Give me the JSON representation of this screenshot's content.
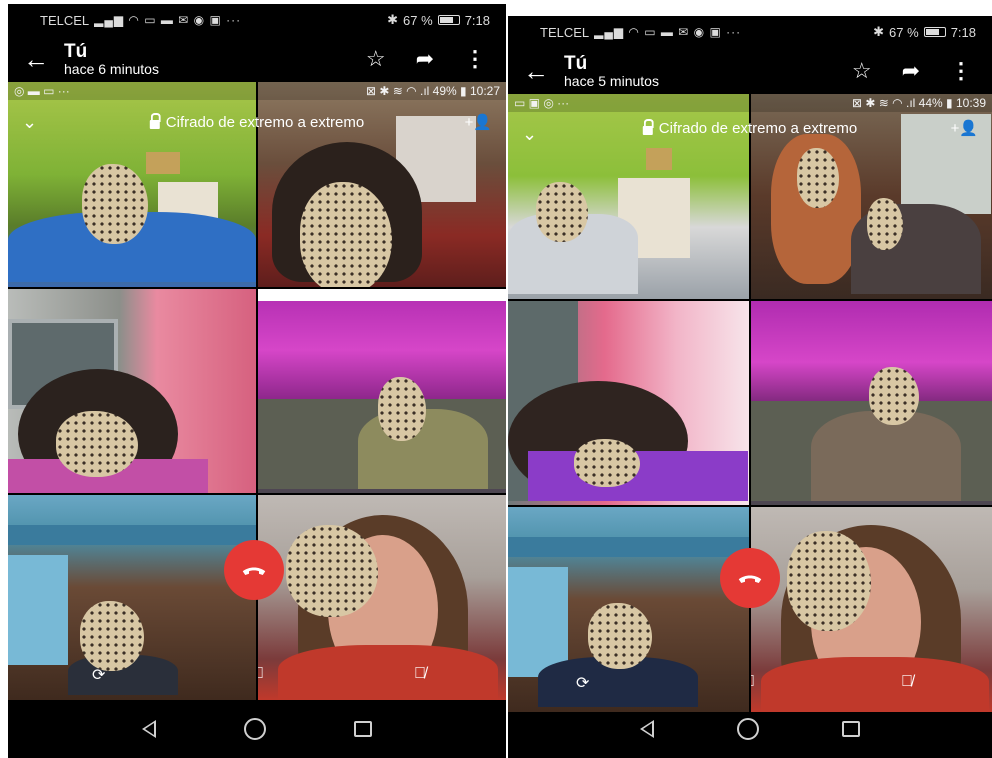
{
  "screens": [
    {
      "carrier": "TELCEL",
      "bluetooth_icon": "bluetooth-icon",
      "battery_percent": "67 %",
      "battery_level": 0.67,
      "time": "7:18",
      "contact_name": "Tú",
      "last_seen": "hace 6 minutos",
      "inner_status": {
        "battery": "49%",
        "time": "10:27"
      },
      "encryption_text": "Cifrado de extremo a extremo",
      "add_participant": "+👤"
    },
    {
      "carrier": "TELCEL",
      "bluetooth_icon": "bluetooth-icon",
      "battery_percent": "67 %",
      "battery_level": 0.67,
      "time": "7:18",
      "contact_name": "Tú",
      "last_seen": "hace 5 minutos",
      "inner_status": {
        "battery": "44%",
        "time": "10:39"
      },
      "encryption_text": "Cifrado de extremo a extremo",
      "add_participant": "+👤"
    }
  ],
  "colors": {
    "end_call": "#e53935",
    "status_text": "#dcdcdc",
    "face_blur": "#d8c7a4"
  },
  "icons": {
    "back": "arrow-left-icon",
    "star": "star-icon",
    "share": "share-arrow-icon",
    "menu": "more-vert-icon",
    "chevron": "chevron-down-icon",
    "lock": "lock-icon",
    "add_person": "add-person-icon",
    "end_call": "end-call-icon",
    "switch_camera": "switch-camera-icon",
    "video_off": "video-off-icon",
    "mic_off": "mic-off-icon",
    "nav_back": "nav-back-icon",
    "nav_home": "nav-home-icon",
    "nav_recents": "nav-recents-icon"
  }
}
